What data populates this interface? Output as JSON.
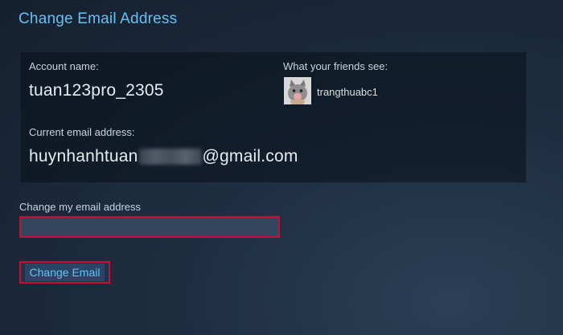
{
  "page": {
    "title": "Change Email Address"
  },
  "account": {
    "name_label": "Account name:",
    "name": "tuan123pro_2305",
    "friends_label": "What your friends see:",
    "persona_name": "trangthuabc1",
    "avatar_icon": "cat-avatar-icon",
    "email_label": "Current email address:",
    "email_prefix": "huynhanhtuan",
    "email_suffix": "@gmail.com"
  },
  "form": {
    "change_label": "Change my email address",
    "input_value": "",
    "button_label": "Change Email"
  },
  "colors": {
    "accent": "#66c0f4",
    "highlight_border": "#c8102e",
    "input_bg": "#32465d"
  }
}
